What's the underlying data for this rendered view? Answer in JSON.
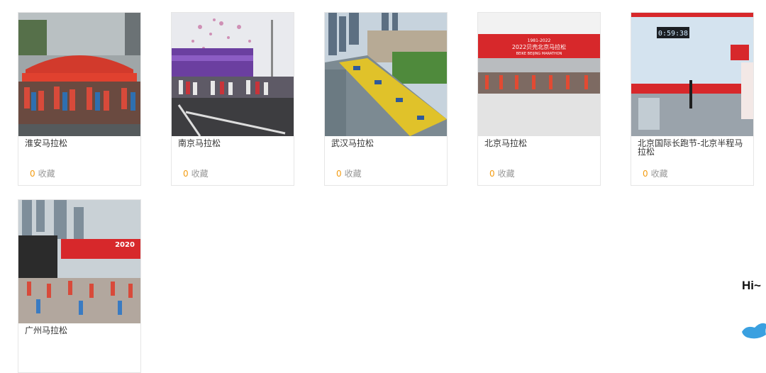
{
  "cards": [
    {
      "title": "淮安马拉松",
      "fav_count": "0",
      "fav_label": "收藏",
      "image": "marathon-start-photo"
    },
    {
      "title": "南京马拉松",
      "fav_count": "0",
      "fav_label": "收藏",
      "image": "marathon-start-confetti-photo"
    },
    {
      "title": "武汉马拉松",
      "fav_count": "0",
      "fav_label": "收藏",
      "image": "marathon-crowd-aerial-photo"
    },
    {
      "title": "北京马拉松",
      "fav_count": "0",
      "fav_label": "收藏",
      "image": "marathon-start-arch-photo"
    },
    {
      "title": "北京国际长跑节-北京半程马拉松",
      "fav_count": "0",
      "fav_label": "收藏",
      "image": "half-marathon-finish-photo"
    },
    {
      "title": "广州马拉松",
      "fav_count": "",
      "fav_label": "",
      "image": "marathon-start-city-photo"
    }
  ],
  "overlay": {
    "greeting": "Hi~"
  },
  "colors": {
    "accent": "#f39c12",
    "border": "#e6e6e6",
    "title": "#333333",
    "muted": "#999999"
  },
  "photo_banners": {
    "beijing_years": "1981-2022",
    "beijing_title": "2022贝壳北京马拉松",
    "beijing_sub": "BEIKE BEIJING MARATHON",
    "guangzhou_year": "2020",
    "halfmarathon_clock": "0:59:38"
  }
}
